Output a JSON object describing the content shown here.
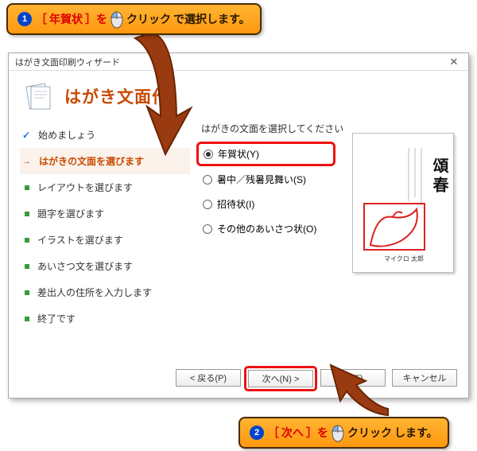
{
  "callout1": {
    "num": "1",
    "before": "［",
    "target": "年賀状",
    "after": "］を",
    "action": "クリック",
    "tail": "で選択します。"
  },
  "callout2": {
    "num": "2",
    "before": "［",
    "target": "次へ",
    "after": "］を",
    "action": "クリック",
    "tail": "します。"
  },
  "window": {
    "title": "はがき文面印刷ウィザード",
    "close": "✕",
    "heading": "はがき文面作"
  },
  "steps": [
    {
      "state": "done",
      "label": "始めましょう"
    },
    {
      "state": "current",
      "label": "はがきの文面を選びます"
    },
    {
      "state": "todo",
      "label": "レイアウトを選びます"
    },
    {
      "state": "todo",
      "label": "題字を選びます"
    },
    {
      "state": "todo",
      "label": "イラストを選びます"
    },
    {
      "state": "todo",
      "label": "あいさつ文を選びます"
    },
    {
      "state": "todo",
      "label": "差出人の住所を入力します"
    },
    {
      "state": "todo",
      "label": "終了です"
    }
  ],
  "content": {
    "prompt": "はがきの文面を選択してください",
    "options": [
      {
        "label": "年賀状(Y)",
        "selected": true
      },
      {
        "label": "暑中／残暑見舞い(S)",
        "selected": false
      },
      {
        "label": "招待状(I)",
        "selected": false
      },
      {
        "label": "その他のあいさつ状(O)",
        "selected": false
      }
    ]
  },
  "preview": {
    "title_vert": "頌春",
    "name": "マイクロ 太郎"
  },
  "buttons": {
    "back": "< 戻る(P)",
    "next": "次へ(N) >",
    "finish": "了(F)",
    "cancel": "キャンセル"
  }
}
